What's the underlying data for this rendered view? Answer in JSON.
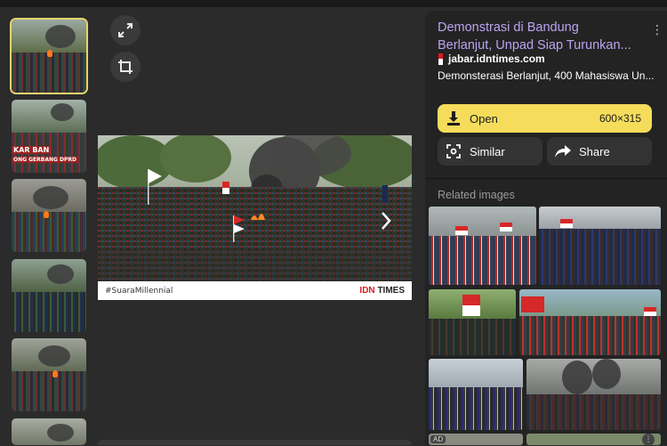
{
  "viewer": {
    "expand_icon": "expand-icon",
    "crop_icon": "crop-icon",
    "main_image": {
      "caption_left": "#SuaraMillennial",
      "caption_brand_idn": "IDN",
      "caption_brand_times": "TIMES"
    },
    "thumbnail_overlay_text": [
      "KAR BAN",
      "ONG GERBANG DPRD"
    ]
  },
  "panel": {
    "title_line1": "Demonstrasi di Bandung",
    "title_line2": "Berlanjut, Unpad Siap Turunkan...",
    "source_domain": "jabar.idntimes.com",
    "description": "Demonsterasi Berlanjut, 400 Mahasiswa Un...",
    "open_label": "Open",
    "image_size": "600×315",
    "similar_label": "Similar",
    "share_label": "Share",
    "related_label": "Related images",
    "ad_label": "AD"
  },
  "colors": {
    "accent_yellow": "#f5dc5b",
    "title_purple": "#b9a5f2",
    "brand_red": "#e01b22"
  }
}
